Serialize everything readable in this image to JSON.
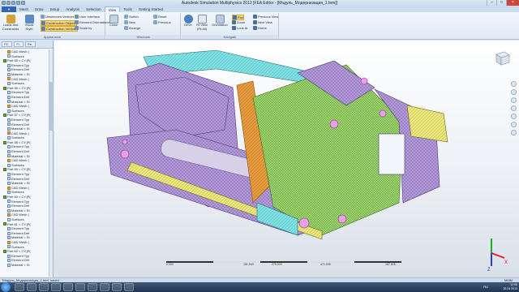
{
  "app": {
    "title": "Autodesk Simulation Multiphysics 2012   [FEA Editor - [Модуль_Модернизация_1.fem]]"
  },
  "tabs": {
    "file": "",
    "items": [
      "Mesh",
      "Draw",
      "Setup",
      "Analysis",
      "Selection",
      "View",
      "Tools",
      "Getting Started"
    ],
    "active": "View"
  },
  "ribbon": {
    "loads": "Loads and Constraints",
    "visual": "Visual Style",
    "appearance_items": [
      "Unselected Vertices",
      "Construction Objects",
      "Construction Vertices"
    ],
    "display_items": [
      "User Interface",
      "Element Orientations",
      "Scale by"
    ],
    "close": "Close",
    "windows_items": [
      "Switch",
      "New",
      "Arrange",
      "Reset",
      "Previous"
    ],
    "drive": "Drive",
    "fit": "Fit View (Fit All)",
    "orient": "Orientation",
    "view_items": [
      "Pan",
      "Zoom",
      "Look At",
      "Previous View",
      "Next View",
      "Home"
    ],
    "groups": [
      "Appearance",
      "Windows",
      "Navigate"
    ]
  },
  "browser": {
    "tabs": [
      "FE..",
      "Fi..",
      "Re.."
    ],
    "rows": [
      {
        "t": "CAD Mesh (",
        "k": "mesh"
      },
      {
        "t": "Surfaces",
        "k": ""
      },
      {
        "t": "Part 55 < CY.[P(",
        "k": "part"
      },
      {
        "t": "Element Typ",
        "k": ""
      },
      {
        "t": "Element Def",
        "k": ""
      },
      {
        "t": "Material < St",
        "k": ""
      },
      {
        "t": "CAD Mesh (",
        "k": "mesh"
      },
      {
        "t": "Surfaces",
        "k": ""
      },
      {
        "t": "Part 56 < CY.[P(",
        "k": "part"
      },
      {
        "t": "Element Typ",
        "k": ""
      },
      {
        "t": "Element Def",
        "k": ""
      },
      {
        "t": "Material < St",
        "k": ""
      },
      {
        "t": "CAD Mesh (",
        "k": "mesh"
      },
      {
        "t": "Surfaces",
        "k": ""
      },
      {
        "t": "Part 57 < CY.[P(",
        "k": "part"
      },
      {
        "t": "Element Typ",
        "k": ""
      },
      {
        "t": "Element Def",
        "k": ""
      },
      {
        "t": "Material < St",
        "k": ""
      },
      {
        "t": "CAD Mesh (",
        "k": "mesh"
      },
      {
        "t": "Surfaces",
        "k": ""
      },
      {
        "t": "Part 58 < CY.[P(",
        "k": "part"
      },
      {
        "t": "Element Typ",
        "k": ""
      },
      {
        "t": "Element Def",
        "k": ""
      },
      {
        "t": "Material < St",
        "k": ""
      },
      {
        "t": "CAD Mesh (",
        "k": "mesh"
      },
      {
        "t": "Surfaces",
        "k": ""
      },
      {
        "t": "Part 59 < CY.[P(",
        "k": "part"
      },
      {
        "t": "Element Typ",
        "k": ""
      },
      {
        "t": "Element Def",
        "k": ""
      },
      {
        "t": "Material < St",
        "k": ""
      },
      {
        "t": "CAD Mesh (",
        "k": "mesh"
      },
      {
        "t": "Surfaces",
        "k": ""
      },
      {
        "t": "Part 60 < CY.[P(",
        "k": "part"
      },
      {
        "t": "Element Typ",
        "k": ""
      },
      {
        "t": "Element Def",
        "k": ""
      },
      {
        "t": "Material < St",
        "k": ""
      },
      {
        "t": "CAD Mesh (",
        "k": "mesh"
      },
      {
        "t": "Surfaces",
        "k": ""
      },
      {
        "t": "Part 61 < CY.[P(",
        "k": "part"
      },
      {
        "t": "Element Typ",
        "k": ""
      },
      {
        "t": "Element Def",
        "k": ""
      },
      {
        "t": "Material < St",
        "k": ""
      },
      {
        "t": "CAD Mesh (",
        "k": "mesh"
      },
      {
        "t": "Surfaces",
        "k": ""
      },
      {
        "t": "Part 62 < CY.[P(",
        "k": "part"
      },
      {
        "t": "Element Typ",
        "k": ""
      },
      {
        "t": "Element Def",
        "k": ""
      },
      {
        "t": "Material < St",
        "k": ""
      }
    ]
  },
  "ruler": {
    "labels": [
      "0.000",
      "181.543",
      "279.039",
      "471.095",
      "187.926"
    ]
  },
  "status": {
    "file": "\"Модуль_Модернизация_1.fem\" saved",
    "units": "MMM"
  },
  "taskbar": {
    "lang": "RU",
    "time": "12:05",
    "date": "26.04.2013"
  },
  "colors": {
    "accent": "#2c66b8",
    "violet": "#b49ad8",
    "cyan": "#7fe0e3",
    "green": "#9ad36b",
    "orange": "#e59a3e",
    "yellow": "#e9e57a"
  }
}
